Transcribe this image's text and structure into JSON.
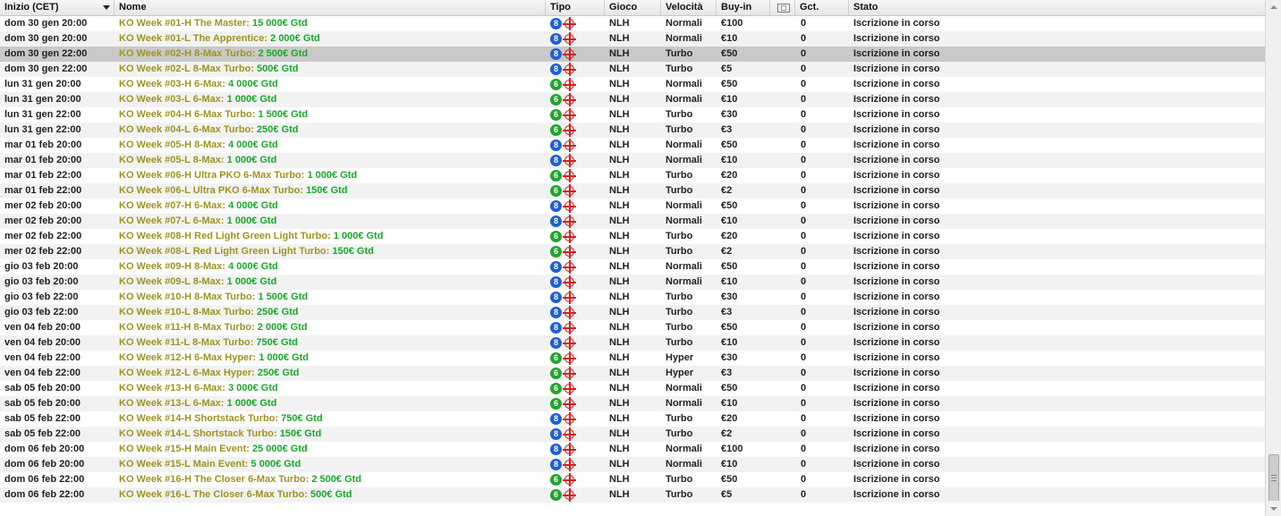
{
  "columns": {
    "inizio": "Inizio (CET)",
    "nome": "Nome",
    "tipo": "Tipo",
    "gioco": "Gioco",
    "velocita": "Velocità",
    "buyin": "Buy-in",
    "ticket_icon": "ticket-icon",
    "gct": "Gct.",
    "stato": "Stato"
  },
  "colors": {
    "name": "#a09320",
    "gtd": "#1aa82a",
    "badge_8": "#1f5fd6",
    "badge_6": "#22a52e",
    "target": "#d42020",
    "selected_row": "#c9c9c9"
  },
  "selected_index": 2,
  "rows": [
    {
      "time": "dom 30 gen 20:00",
      "name": "KO Week #01-H The Master:",
      "gtd": "15 000€ Gtd",
      "tipo": "8",
      "gioco": "NLH",
      "vel": "Normali",
      "buy": "€100",
      "gct": "0",
      "stato": "Iscrizione in corso"
    },
    {
      "time": "dom 30 gen 20:00",
      "name": "KO Week #01-L The Apprentice:",
      "gtd": "2 000€ Gtd",
      "tipo": "8",
      "gioco": "NLH",
      "vel": "Normali",
      "buy": "€10",
      "gct": "0",
      "stato": "Iscrizione in corso"
    },
    {
      "time": "dom 30 gen 22:00",
      "name": "KO Week #02-H 8-Max Turbo:",
      "gtd": "2 500€ Gtd",
      "tipo": "8",
      "gioco": "NLH",
      "vel": "Turbo",
      "buy": "€50",
      "gct": "0",
      "stato": "Iscrizione in corso"
    },
    {
      "time": "dom 30 gen 22:00",
      "name": "KO Week #02-L 8-Max Turbo:",
      "gtd": "500€ Gtd",
      "tipo": "8",
      "gioco": "NLH",
      "vel": "Turbo",
      "buy": "€5",
      "gct": "0",
      "stato": "Iscrizione in corso"
    },
    {
      "time": "lun 31 gen 20:00",
      "name": "KO Week #03-H 6-Max:",
      "gtd": "4 000€ Gtd",
      "tipo": "6",
      "gioco": "NLH",
      "vel": "Normali",
      "buy": "€50",
      "gct": "0",
      "stato": "Iscrizione in corso"
    },
    {
      "time": "lun 31 gen 20:00",
      "name": "KO Week #03-L 6-Max:",
      "gtd": "1 000€ Gtd",
      "tipo": "6",
      "gioco": "NLH",
      "vel": "Normali",
      "buy": "€10",
      "gct": "0",
      "stato": "Iscrizione in corso"
    },
    {
      "time": "lun 31 gen 22:00",
      "name": "KO Week #04-H 6-Max Turbo:",
      "gtd": "1 500€ Gtd",
      "tipo": "6",
      "gioco": "NLH",
      "vel": "Turbo",
      "buy": "€30",
      "gct": "0",
      "stato": "Iscrizione in corso"
    },
    {
      "time": "lun 31 gen 22:00",
      "name": "KO Week #04-L 6-Max Turbo:",
      "gtd": "250€ Gtd",
      "tipo": "6",
      "gioco": "NLH",
      "vel": "Turbo",
      "buy": "€3",
      "gct": "0",
      "stato": "Iscrizione in corso"
    },
    {
      "time": "mar 01 feb 20:00",
      "name": "KO Week #05-H 8-Max:",
      "gtd": "4 000€ Gtd",
      "tipo": "8",
      "gioco": "NLH",
      "vel": "Normali",
      "buy": "€50",
      "gct": "0",
      "stato": "Iscrizione in corso"
    },
    {
      "time": "mar 01 feb 20:00",
      "name": "KO Week #05-L 8-Max:",
      "gtd": "1 000€ Gtd",
      "tipo": "8",
      "gioco": "NLH",
      "vel": "Normali",
      "buy": "€10",
      "gct": "0",
      "stato": "Iscrizione in corso"
    },
    {
      "time": "mar 01 feb 22:00",
      "name": "KO Week #06-H Ultra PKO 6-Max Turbo:",
      "gtd": "1 000€ Gtd",
      "tipo": "6",
      "gioco": "NLH",
      "vel": "Turbo",
      "buy": "€20",
      "gct": "0",
      "stato": "Iscrizione in corso"
    },
    {
      "time": "mar 01 feb 22:00",
      "name": "KO Week #06-L Ultra PKO 6-Max Turbo:",
      "gtd": "150€ Gtd",
      "tipo": "6",
      "gioco": "NLH",
      "vel": "Turbo",
      "buy": "€2",
      "gct": "0",
      "stato": "Iscrizione in corso"
    },
    {
      "time": "mer 02 feb 20:00",
      "name": "KO Week #07-H 6-Max:",
      "gtd": "4 000€ Gtd",
      "tipo": "8",
      "gioco": "NLH",
      "vel": "Normali",
      "buy": "€50",
      "gct": "0",
      "stato": "Iscrizione in corso"
    },
    {
      "time": "mer 02 feb 20:00",
      "name": "KO Week #07-L 6-Max:",
      "gtd": "1 000€ Gtd",
      "tipo": "8",
      "gioco": "NLH",
      "vel": "Normali",
      "buy": "€10",
      "gct": "0",
      "stato": "Iscrizione in corso"
    },
    {
      "time": "mer 02 feb 22:00",
      "name": "KO Week #08-H Red Light Green Light Turbo:",
      "gtd": "1 000€ Gtd",
      "tipo": "6",
      "gioco": "NLH",
      "vel": "Turbo",
      "buy": "€20",
      "gct": "0",
      "stato": "Iscrizione in corso"
    },
    {
      "time": "mer 02 feb 22:00",
      "name": "KO Week #08-L Red Light Green Light Turbo:",
      "gtd": "150€ Gtd",
      "tipo": "6",
      "gioco": "NLH",
      "vel": "Turbo",
      "buy": "€2",
      "gct": "0",
      "stato": "Iscrizione in corso"
    },
    {
      "time": "gio 03 feb 20:00",
      "name": "KO Week #09-H 8-Max:",
      "gtd": "4 000€ Gtd",
      "tipo": "8",
      "gioco": "NLH",
      "vel": "Normali",
      "buy": "€50",
      "gct": "0",
      "stato": "Iscrizione in corso"
    },
    {
      "time": "gio 03 feb 20:00",
      "name": "KO Week #09-L 8-Max:",
      "gtd": "1 000€ Gtd",
      "tipo": "8",
      "gioco": "NLH",
      "vel": "Normali",
      "buy": "€10",
      "gct": "0",
      "stato": "Iscrizione in corso"
    },
    {
      "time": "gio 03 feb 22:00",
      "name": "KO Week #10-H 8-Max Turbo:",
      "gtd": "1 500€ Gtd",
      "tipo": "8",
      "gioco": "NLH",
      "vel": "Turbo",
      "buy": "€30",
      "gct": "0",
      "stato": "Iscrizione in corso"
    },
    {
      "time": "gio 03 feb 22:00",
      "name": "KO Week #10-L 8-Max Turbo:",
      "gtd": "250€ Gtd",
      "tipo": "8",
      "gioco": "NLH",
      "vel": "Turbo",
      "buy": "€3",
      "gct": "0",
      "stato": "Iscrizione in corso"
    },
    {
      "time": "ven 04 feb 20:00",
      "name": "KO Week #11-H 8-Max Turbo:",
      "gtd": "2 000€ Gtd",
      "tipo": "8",
      "gioco": "NLH",
      "vel": "Turbo",
      "buy": "€50",
      "gct": "0",
      "stato": "Iscrizione in corso"
    },
    {
      "time": "ven 04 feb 20:00",
      "name": "KO Week #11-L 8-Max Turbo:",
      "gtd": "750€ Gtd",
      "tipo": "8",
      "gioco": "NLH",
      "vel": "Turbo",
      "buy": "€10",
      "gct": "0",
      "stato": "Iscrizione in corso"
    },
    {
      "time": "ven 04 feb 22:00",
      "name": "KO Week #12-H 6-Max Hyper:",
      "gtd": "1 000€ Gtd",
      "tipo": "6",
      "gioco": "NLH",
      "vel": "Hyper",
      "buy": "€30",
      "gct": "0",
      "stato": "Iscrizione in corso"
    },
    {
      "time": "ven 04 feb 22:00",
      "name": "KO Week #12-L 6-Max Hyper:",
      "gtd": "250€ Gtd",
      "tipo": "6",
      "gioco": "NLH",
      "vel": "Hyper",
      "buy": "€3",
      "gct": "0",
      "stato": "Iscrizione in corso"
    },
    {
      "time": "sab 05 feb 20:00",
      "name": "KO Week #13-H 6-Max:",
      "gtd": "3 000€ Gtd",
      "tipo": "6",
      "gioco": "NLH",
      "vel": "Normali",
      "buy": "€50",
      "gct": "0",
      "stato": "Iscrizione in corso"
    },
    {
      "time": "sab 05 feb 20:00",
      "name": "KO Week #13-L 6-Max:",
      "gtd": "1 000€ Gtd",
      "tipo": "6",
      "gioco": "NLH",
      "vel": "Normali",
      "buy": "€10",
      "gct": "0",
      "stato": "Iscrizione in corso"
    },
    {
      "time": "sab 05 feb 22:00",
      "name": "KO Week #14-H Shortstack Turbo:",
      "gtd": "750€ Gtd",
      "tipo": "8",
      "gioco": "NLH",
      "vel": "Turbo",
      "buy": "€20",
      "gct": "0",
      "stato": "Iscrizione in corso"
    },
    {
      "time": "sab 05 feb 22:00",
      "name": "KO Week #14-L Shortstack Turbo:",
      "gtd": "150€ Gtd",
      "tipo": "8",
      "gioco": "NLH",
      "vel": "Turbo",
      "buy": "€2",
      "gct": "0",
      "stato": "Iscrizione in corso"
    },
    {
      "time": "dom 06 feb 20:00",
      "name": "KO Week #15-H Main Event:",
      "gtd": "25 000€ Gtd",
      "tipo": "8",
      "gioco": "NLH",
      "vel": "Normali",
      "buy": "€100",
      "gct": "0",
      "stato": "Iscrizione in corso"
    },
    {
      "time": "dom 06 feb 20:00",
      "name": "KO Week #15-L Main Event:",
      "gtd": "5 000€ Gtd",
      "tipo": "8",
      "gioco": "NLH",
      "vel": "Normali",
      "buy": "€10",
      "gct": "0",
      "stato": "Iscrizione in corso"
    },
    {
      "time": "dom 06 feb 22:00",
      "name": "KO Week #16-H The Closer 6-Max Turbo:",
      "gtd": "2 500€ Gtd",
      "tipo": "6",
      "gioco": "NLH",
      "vel": "Turbo",
      "buy": "€50",
      "gct": "0",
      "stato": "Iscrizione in corso"
    },
    {
      "time": "dom 06 feb 22:00",
      "name": "KO Week #16-L The Closer 6-Max Turbo:",
      "gtd": "500€ Gtd",
      "tipo": "6",
      "gioco": "NLH",
      "vel": "Turbo",
      "buy": "€5",
      "gct": "0",
      "stato": "Iscrizione in corso"
    }
  ]
}
